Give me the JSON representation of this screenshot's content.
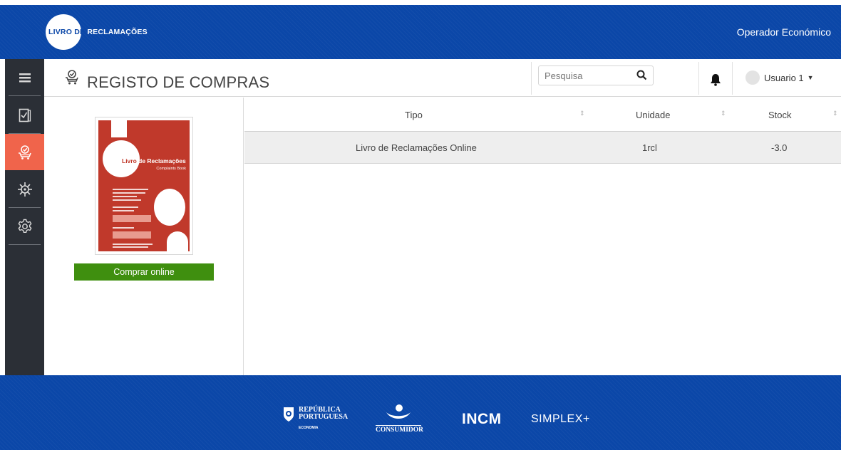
{
  "header": {
    "logo_part1": "LIVRO DE",
    "logo_part2": "RECLAMAÇÕES",
    "operator_label": "Operador Económico",
    "bg_color": "#0b47a8"
  },
  "sidebar": {
    "active_color": "#f0644b",
    "items": [
      {
        "icon": "menu-icon"
      },
      {
        "icon": "book-check-icon"
      },
      {
        "icon": "cart-icon",
        "active": true
      },
      {
        "icon": "virus-icon"
      },
      {
        "icon": "gear-icon"
      }
    ]
  },
  "page": {
    "title": "REGISTO DE COMPRAS",
    "title_icon": "cart-icon"
  },
  "search": {
    "placeholder": "Pesquisa",
    "value": ""
  },
  "user": {
    "name": "Usuario 1"
  },
  "product": {
    "book_title_dark": "Livro",
    "book_title_rest": " de Reclamações",
    "book_subtitle": "Complaints Book",
    "buy_label": "Comprar online",
    "buy_color": "#3f8f0f"
  },
  "table": {
    "columns": [
      "Tipo",
      "Unidade",
      "Stock"
    ],
    "rows": [
      {
        "tipo": "Livro de Reclamações Online",
        "unidade": "1rcl",
        "stock": "-3.0"
      }
    ]
  },
  "footer": {
    "republica_line1": "REPÚBLICA",
    "republica_line2": "PORTUGUESA",
    "republica_small": "ECONOMIA",
    "consumidor": "CONSUMIDOR",
    "incm": "INCM",
    "simplex": "SIMPLEX+"
  }
}
